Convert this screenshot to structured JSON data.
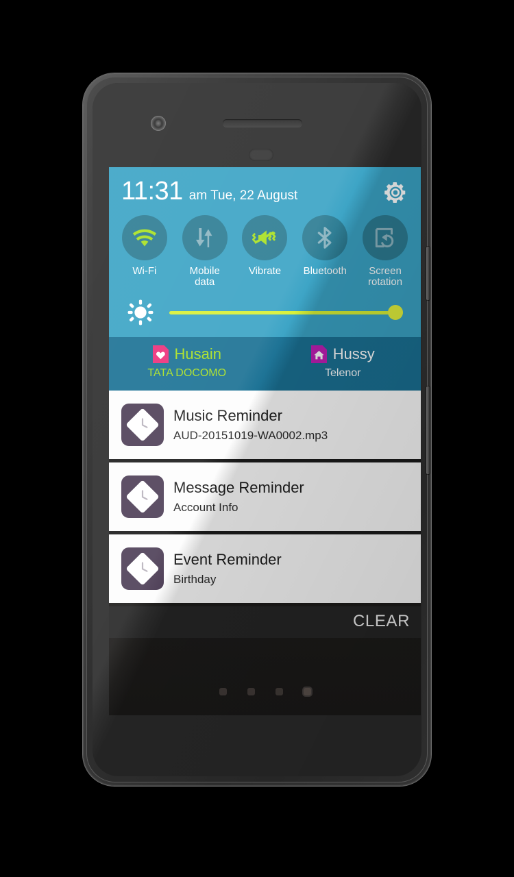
{
  "device": {
    "camera_icon": "front-camera",
    "speaker_icon": "earpiece-speaker",
    "sensor_icon": "proximity-sensor"
  },
  "colors": {
    "header_blue": "#3aa3c5",
    "sim_row_blue": "#1a7194",
    "toggle_circle": "#2c7c93",
    "accent_green": "#a8e021",
    "slider_yellow": "#d8f136",
    "notif_icon_purple": "#4e3f57",
    "sim1_badge_pink": "#ec2f7a",
    "sim2_badge_magenta": "#c01fb5"
  },
  "status_bar": {
    "time": "11:31",
    "date": "am Tue, 22 August",
    "settings_icon": "gear-icon"
  },
  "quick_settings": {
    "tiles": [
      {
        "label": "Wi-Fi",
        "icon": "wifi-icon",
        "state": "on"
      },
      {
        "label": "Mobile\ndata",
        "icon": "mobile-data-icon",
        "state": "off"
      },
      {
        "label": "Vibrate",
        "icon": "vibrate-icon",
        "state": "on"
      },
      {
        "label": "Bluetooth",
        "icon": "bluetooth-icon",
        "state": "off"
      },
      {
        "label": "Screen\nrotation",
        "icon": "screen-rotation-icon",
        "state": "off"
      }
    ],
    "brightness": {
      "icon": "brightness-icon",
      "value": 100
    }
  },
  "sim_cards": [
    {
      "name": "Husain",
      "carrier": "TATA DOCOMO",
      "icon": "sim-heart-icon"
    },
    {
      "name": "Hussy",
      "carrier": "Telenor",
      "icon": "sim-home-icon"
    }
  ],
  "notifications": [
    {
      "title": "Music Reminder",
      "subtitle": "AUD-20151019-WA0002.mp3",
      "icon": "reminder-clock-icon"
    },
    {
      "title": "Message Reminder",
      "subtitle": "Account Info",
      "icon": "reminder-clock-icon"
    },
    {
      "title": "Event Reminder",
      "subtitle": "Birthday",
      "icon": "reminder-clock-icon"
    }
  ],
  "actions": {
    "clear_label": "CLEAR"
  },
  "home": {
    "page_count": 4,
    "active_page": 4
  }
}
